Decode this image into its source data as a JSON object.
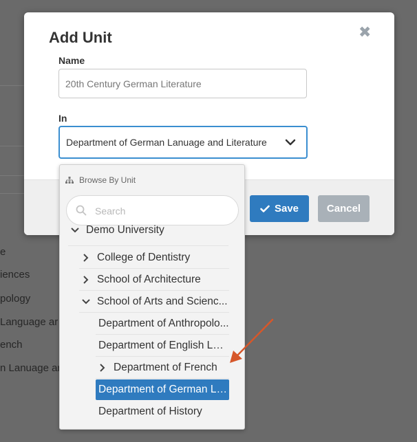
{
  "background": {
    "rows": [
      "e",
      "iences",
      "pology",
      "Language ar",
      "ench",
      "n Lanuage ar"
    ]
  },
  "modal": {
    "title": "Add Unit",
    "close_icon": "close-icon",
    "name_label": "Name",
    "name_value": "20th Century German Literature",
    "in_label": "In",
    "in_value": "Department of German Lanuage and Literature",
    "save_label": "Save",
    "cancel_label": "Cancel"
  },
  "dropdown": {
    "header": "Browse By Unit",
    "search_placeholder": "Search",
    "items": [
      {
        "label": "Demo University",
        "level": 0,
        "expanded": true
      },
      {
        "label": "College of Dentistry",
        "level": 1,
        "expandable": true
      },
      {
        "label": "School of Architecture",
        "level": 1,
        "expandable": true
      },
      {
        "label": "School of Arts and Scienc...",
        "level": 1,
        "expanded": true
      },
      {
        "label": "Department of Anthropolo...",
        "level": 2
      },
      {
        "label": "Department of English Lan...",
        "level": 2
      },
      {
        "label": "Department of French",
        "level": 2,
        "expandable": true
      },
      {
        "label": "Department of German La...",
        "level": 2,
        "selected": true
      },
      {
        "label": "Department of History",
        "level": 2
      }
    ]
  },
  "colors": {
    "accent": "#2f7bbf",
    "cancel": "#a9b1b8",
    "annotation_arrow": "#d6572a"
  }
}
